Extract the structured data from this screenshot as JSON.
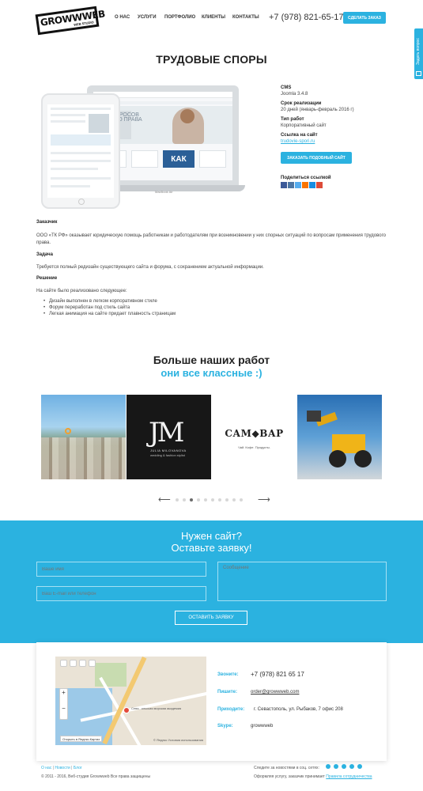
{
  "header": {
    "logo": "GROWWWEB",
    "logo_sub": "WEB STUDIO",
    "nav": [
      {
        "label": "О НАС"
      },
      {
        "label": "УСЛУГИ"
      },
      {
        "label": "ПОРТФОЛИО"
      },
      {
        "label": "КЛИЕНТЫ"
      },
      {
        "label": "КОНТАКТЫ"
      }
    ],
    "phone": "+7 (978) 821-65-17",
    "order_label": "СДЕЛАТЬ ЗАКАЗ"
  },
  "side_tab": {
    "label": "Задать вопрос",
    "icon": "mail-icon"
  },
  "page_title": "ТРУДОВЫЕ СПОРЫ",
  "mockup": {
    "heading": "ВОГО ПРАВА",
    "heading_top": "ВОПРОСОВ",
    "kak": "КАК",
    "device_label": "MacBook Air"
  },
  "project": {
    "cms_label": "CMS",
    "cms_value": "Joomla 3.4.8",
    "term_label": "Срок реализации",
    "term_value": "20 дней (январь-февраль 2016 г)",
    "type_label": "Тип работ",
    "type_value": "Корпоративный сайт",
    "link_label": "Ссылка на сайт",
    "link_value": "trudovie-spori.ru",
    "similar_label": "ЗАКАЗАТЬ ПОДОБНЫЙ САЙТ",
    "share_label": "Поделиться ссылкой",
    "share_colors": [
      "#3b5998",
      "#4c75a3",
      "#55acee",
      "#f97400",
      "#168de2",
      "#dd4b39"
    ]
  },
  "description": {
    "client_head": "Заказчик",
    "client_text": "ООО «ТК РФ» оказывает юридическую помощь работникам и работодателям при возникновении у них спорных ситуаций по вопросам применения трудового права.",
    "task_head": "Задача",
    "task_text": "Требуется полный редизайн существующего сайта и форума, с сохранением актуальной информации.",
    "solution_head": "Решение",
    "solution_text": "На сайте было реализовано следующее:",
    "items": [
      "Дизайн выполнен в легком корпоративном стиле",
      "Форум переработан под стиль сайта",
      "Легкая анимация на сайте придает плавность страницам"
    ]
  },
  "more": {
    "title": "Больше наших работ",
    "subtitle": "они все классные :)",
    "works": [
      {
        "name": "city"
      },
      {
        "name": "julia",
        "mark": "JM",
        "line1": "JULIA MILOVANOVA",
        "line2": "wedding & fashion stylist"
      },
      {
        "name": "samovar",
        "title": "САМ◆ВАР",
        "sub": "Чай. Кофе. Продукты."
      },
      {
        "name": "loader"
      }
    ],
    "prev_arrow": "⟵",
    "next_arrow": "⟶",
    "dots": 10,
    "active_dot": 3
  },
  "request": {
    "title_1": "Нужен сайт?",
    "title_2": "Оставьте заявку!",
    "name_placeholder": "Ваше имя",
    "contact_placeholder": "Ваш E-mail или телефон",
    "message_placeholder": "Сообщение",
    "submit_label": "ОСТАВИТЬ ЗАЯВКУ"
  },
  "contacts": {
    "call_label": "Звоните:",
    "call_value": "+7 (978) 821 65 17",
    "write_label": "Пишите:",
    "write_value": "order@growwweb.com",
    "come_label": "Приходите:",
    "come_value": "г. Севастополь, ул. Рыбаков, 7 офис 208",
    "skype_label": "Skype:",
    "skype_value": "growwweb",
    "map_open": "Открыть в Яндекс.Картах",
    "map_brand": "© Яндекс  Условия использования",
    "map_place": "Сева...ольская морская академия"
  },
  "footer": {
    "links": [
      "О нас",
      "Новости",
      "Блог"
    ],
    "copyright": "© 2011 - 2016, Веб-студия Growwweb Все права защищены",
    "follow": "Следите за новостями в соц. сетях:",
    "terms_prefix": "Оформляя услугу, заказчик принимает",
    "terms_link": "Правила сотрудничества",
    "social": [
      "vk-icon",
      "twitter-icon",
      "vk-alt-icon",
      "facebook-icon",
      "instagram-icon"
    ]
  }
}
